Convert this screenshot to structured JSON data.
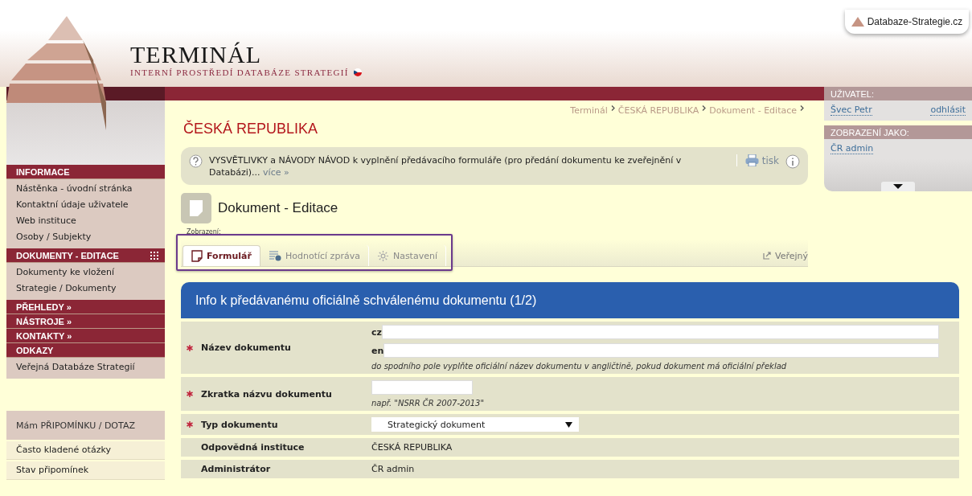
{
  "site_tab": {
    "label": "Databaze-Strategie.cz"
  },
  "header": {
    "title": "TERMINÁL",
    "subtitle": "INTERNÍ PROSTŘEDÍ DATABÁZE STRATEGIÍ"
  },
  "sidebar": {
    "sections": [
      {
        "title": "INFORMACE",
        "grid_icon": false,
        "items": [
          "Nástěnka - úvodní stránka",
          "Kontaktní údaje uživatele",
          "Web instituce",
          "Osoby / Subjekty"
        ]
      },
      {
        "title": "DOKUMENTY - EDITACE",
        "grid_icon": true,
        "items": [
          "Dokumenty ke vložení",
          "Strategie / Dokumenty"
        ]
      },
      {
        "title": "PŘEHLEDY »",
        "grid_icon": false
      },
      {
        "title": "NÁSTROJE »",
        "grid_icon": false
      },
      {
        "title": "KONTAKTY »",
        "grid_icon": false
      },
      {
        "title": "ODKAZY",
        "grid_icon": false,
        "items": [
          "Veřejná Databáze Strategií"
        ]
      }
    ],
    "feedback": {
      "title": "Mám PŘIPOMÍNKU / DOTAZ",
      "items": [
        "Často kladené otázky",
        "Stav připomínek"
      ]
    }
  },
  "breadcrumb": [
    "Terminál",
    "ČESKÁ REPUBLIKA",
    "Dokument - Editace"
  ],
  "page_title": "ČESKÁ REPUBLIKA",
  "help": {
    "text": "VYSVĚTLIVKY a NÁVODY NÁVOD k vyplnění předávacího formuláře (pro předání dokumentu ke zveřejnění v Databázi)...",
    "more": "více »",
    "print": "tisk"
  },
  "document": {
    "title": "Dokument - Editace",
    "view_label": "Zobrazení:",
    "tabs": [
      {
        "label": "Formulář",
        "kind": "form",
        "selected": true
      },
      {
        "label": "Hodnotící zpráva",
        "kind": "report",
        "selected": false
      },
      {
        "label": "Nastavení",
        "kind": "settings",
        "selected": false
      }
    ],
    "public_link": "Veřejný"
  },
  "user_panel": {
    "user_heading": "UŽIVATEL:",
    "user": "Švec Petr",
    "logout": "odhlásit",
    "view_heading": "ZOBRAZENÍ JAKO:",
    "view_as": "ČR admin"
  },
  "form": {
    "title": "Info k předávanému oficiálně schválenému dokumentu (1/2)",
    "rows": [
      {
        "label": "Název dokumentu",
        "kind": "bilingual",
        "required": true,
        "langs": [
          "cz",
          "en"
        ],
        "hint": "do spodního pole vyplňte oficiální název dokumentu v angličtině, pokud dokument má oficiální překlad"
      },
      {
        "label": "Zkratka názvu dokumentu",
        "kind": "text",
        "required": true,
        "hint": "např. \"NSRR ČR 2007-2013\""
      },
      {
        "label": "Typ dokumentu",
        "kind": "select",
        "required": true,
        "value": "Strategický dokument"
      },
      {
        "label": "Odpovědná instituce",
        "kind": "static",
        "required": false,
        "value": "ČESKÁ REPUBLIKA"
      },
      {
        "label": "Administrátor",
        "kind": "static",
        "required": false,
        "value": "ČR admin"
      }
    ]
  }
}
